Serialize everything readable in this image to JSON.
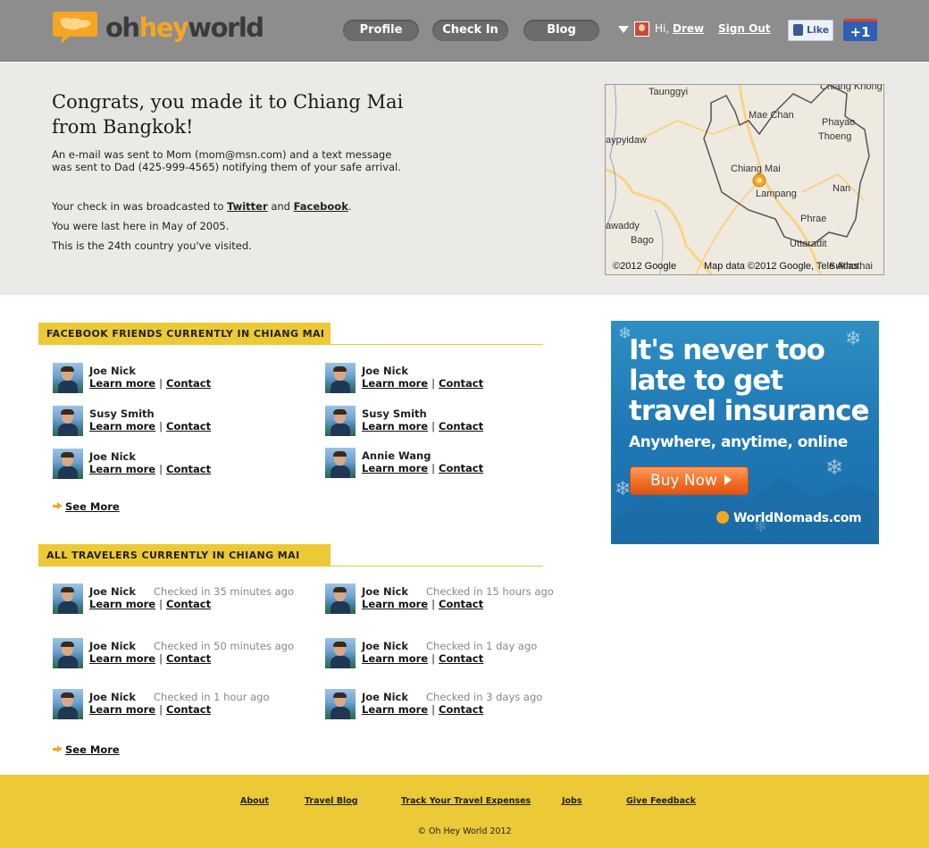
{
  "header": {
    "logo": {
      "oh": "oh",
      "hey": "hey",
      "world": "world"
    },
    "nav": [
      {
        "label": "Profile"
      },
      {
        "label": "Check In"
      },
      {
        "label": "Blog"
      }
    ],
    "user": {
      "greeting": "Hi,",
      "name": "Drew"
    },
    "signout_label": "Sign Out",
    "like_label": "Like",
    "plusone_label": "+1"
  },
  "hero": {
    "title": "Congrats, you made it to Chiang Mai from Bangkok!",
    "sent_text": "An e-mail was sent to Mom (mom@msn.com) and a text message was sent to Dad (425-999-4565) notifying them of your safe arrival.",
    "broadcast_prefix": "Your check in was broadcasted to",
    "twitter_label": "Twitter",
    "and_text": "and",
    "facebook_label": "Facebook",
    "period": ".",
    "last_here": "You were last here in May of 2005.",
    "country_count": "This is the 24th country you've visited."
  },
  "map": {
    "labels": [
      "Taunggyi",
      "Chiang Khong",
      "Mae Chan",
      "Phayao",
      "Thoeng",
      "Chiang Mai",
      "Lampang",
      "Nan",
      "Phrae",
      "Uttaradit",
      "Bago",
      "Sukhothai",
      "aypyidaw",
      "awaddy"
    ],
    "copyright": "Map data ©2012 Google, Tele Atlas",
    "google": "©2012 Google"
  },
  "facebook_friends": {
    "heading": "FACEBOOK FRIENDS CURRENTLY IN CHIANG MAI",
    "items": [
      {
        "name": "Joe Nick"
      },
      {
        "name": "Joe Nick"
      },
      {
        "name": "Susy Smith"
      },
      {
        "name": "Susy Smith"
      },
      {
        "name": "Joe Nick"
      },
      {
        "name": "Annie Wang"
      }
    ],
    "learn_more": "Learn more",
    "separator": "|",
    "contact": "Contact",
    "see_more": "See More"
  },
  "all_travelers": {
    "heading": "ALL TRAVELERS CURRENTLY IN CHIANG MAI",
    "items": [
      {
        "name": "Joe Nick",
        "checked": "Checked in 35 minutes ago"
      },
      {
        "name": "Joe Nick",
        "checked": "Checked in 15 hours ago"
      },
      {
        "name": "Joe Nick",
        "checked": "Checked in 50 minutes ago"
      },
      {
        "name": "Joe Nick",
        "checked": "Checked in 1 day ago"
      },
      {
        "name": "Joe Nick",
        "checked": "Checked in 1 hour ago"
      },
      {
        "name": "Joe Nick",
        "checked": "Checked in 3 days ago"
      }
    ],
    "see_more": "See More"
  },
  "ad": {
    "headline": "It's never too late to get travel insurance",
    "sub": "Anywhere, anytime, online",
    "button": "Buy Now",
    "brand": "WorldNomads.com"
  },
  "footer": {
    "links": [
      "About",
      "Travel Blog",
      "Track Your Travel Expenses",
      "Jobs",
      "Give Feedback"
    ],
    "copyright": "© Oh Hey World 2012"
  },
  "colors": {
    "header_bg": "#8d8d8d",
    "accent_yellow": "#ecc936",
    "logo_orange": "#f5a623",
    "hero_bg": "#ebeae6"
  }
}
